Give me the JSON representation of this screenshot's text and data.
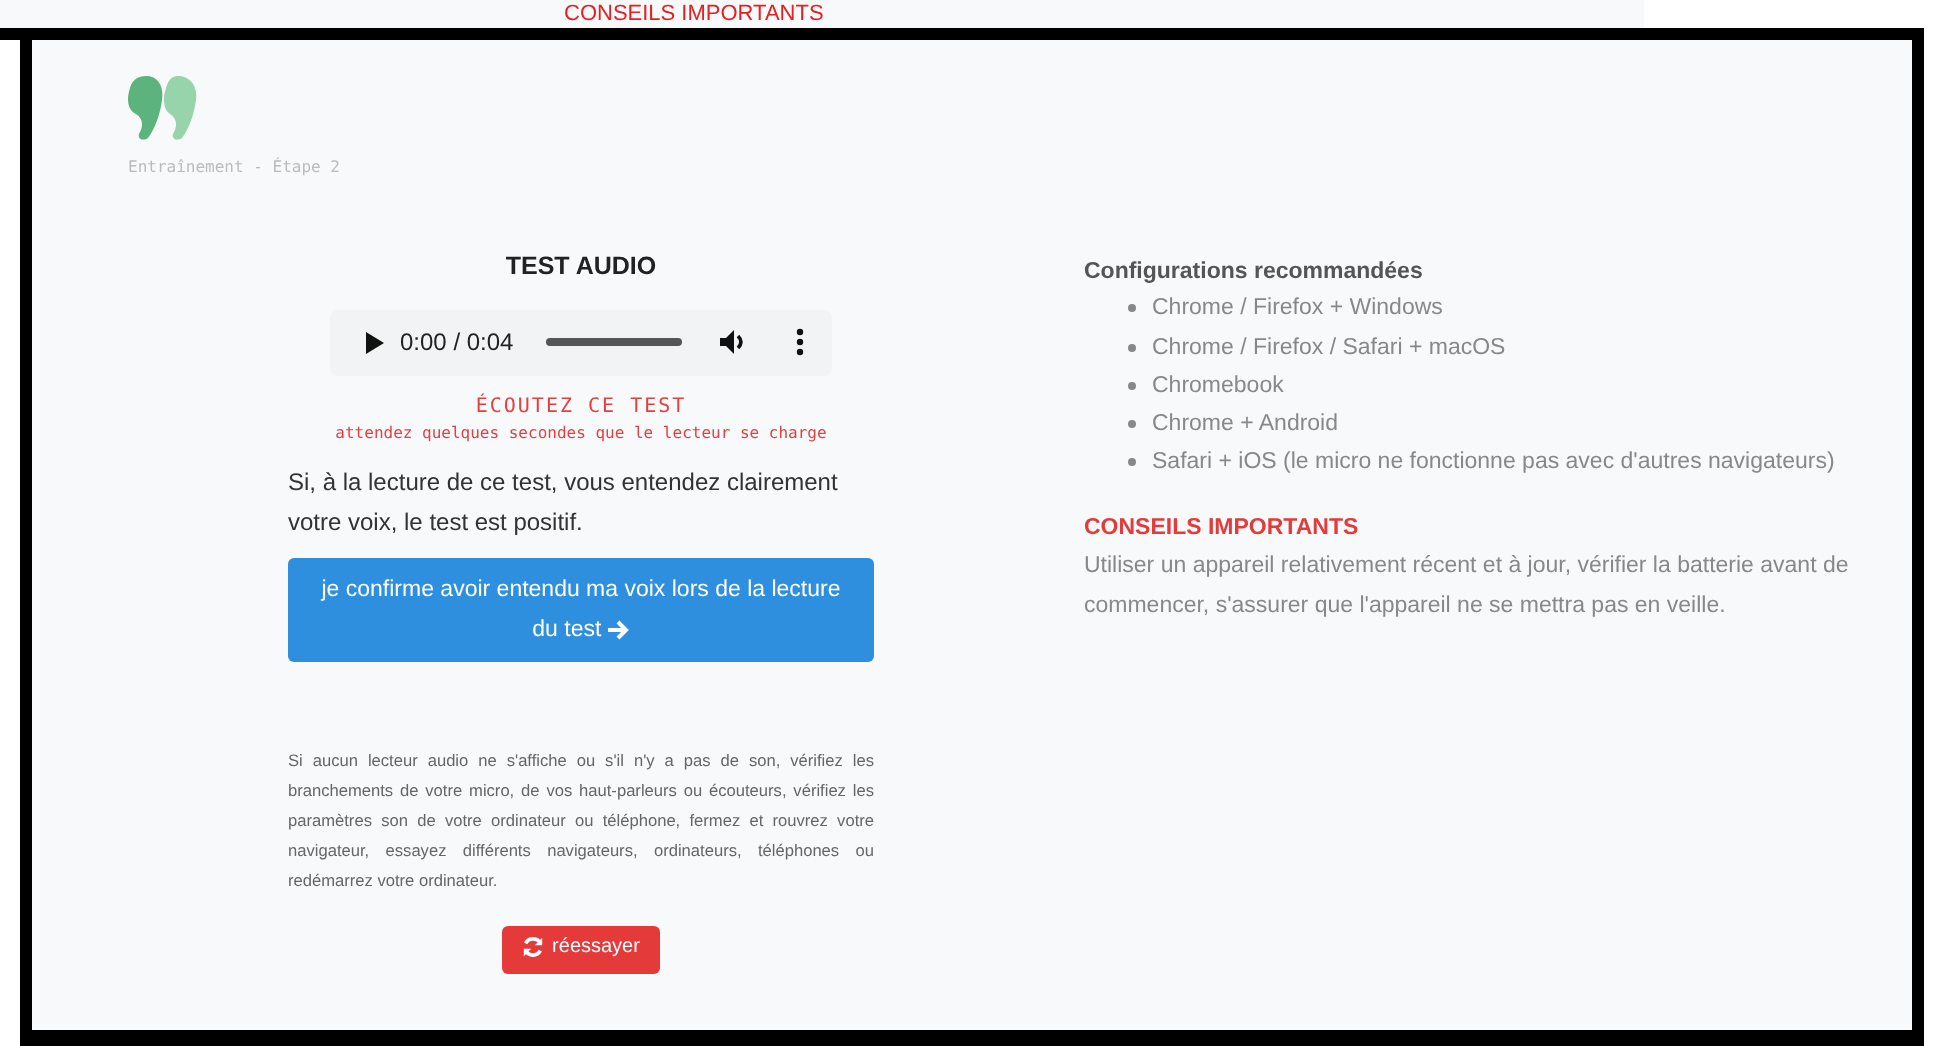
{
  "background_window": {
    "heading": "CONSEILS IMPORTANTS"
  },
  "header": {
    "subtitle": "Entraînement - Étape 2"
  },
  "audio_test": {
    "title": "TEST AUDIO",
    "player": {
      "time": "0:00 / 0:04"
    },
    "notice": "ÉCOUTEZ CE TEST",
    "hint": "attendez quelques secondes que le lecteur se charge",
    "instruction": "Si, à la lecture de ce test, vous entendez clairement votre voix, le test est positif.",
    "confirm_button": "je confirme avoir entendu ma voix lors de la lecture du test",
    "help": "Si aucun lecteur audio ne s'affiche ou s'il n'y a pas de son, vérifiez les branchements de votre micro, de vos haut-parleurs ou écouteurs, vérifiez les paramètres son de votre ordinateur ou téléphone, fermez et rouvrez votre navigateur, essayez différents navigateurs, ordinateurs, téléphones ou redémarrez votre ordinateur.",
    "retry_button": "réessayer"
  },
  "recommended": {
    "title": "Configurations recommandées",
    "items": [
      "Chrome / Firefox + Windows",
      "Chrome / Firefox / Safari + macOS",
      "Chromebook",
      "Chrome + Android",
      "Safari + iOS (le micro ne fonctionne pas avec d'autres navigateurs)"
    ]
  },
  "tips": {
    "title": "CONSEILS IMPORTANTS",
    "text": "Utiliser un appareil relativement récent et à jour, vérifier la batterie avant de commencer, s'assurer que l'appareil ne se mettra pas en veille."
  }
}
